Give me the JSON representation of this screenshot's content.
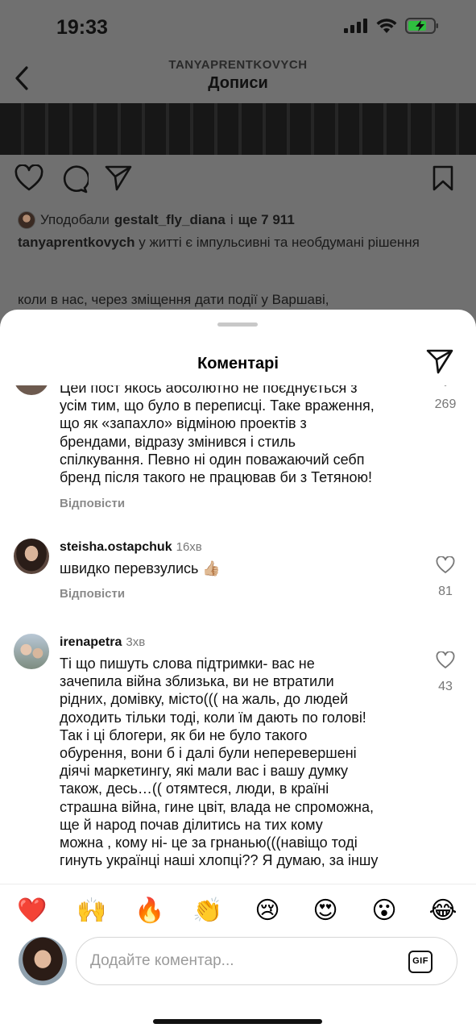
{
  "status_bar": {
    "time": "19:33"
  },
  "post_header": {
    "username": "TANYAPRENTKOVYCH",
    "title": "Дописи"
  },
  "likes": {
    "prefix": "Уподобали",
    "user": "gestalt_fly_diana",
    "joiner": "і",
    "count_text": "ще 7 911"
  },
  "caption": {
    "username": "tanyaprentkovych",
    "text": "у житті є імпульсивні та необдумані рішення",
    "second_line": "коли в нас, через зміщення дати події у Варшаві,"
  },
  "sheet": {
    "title": "Коментарі"
  },
  "comments": [
    {
      "lines": [
        "Цей пост якось абсолютно не поєднується з",
        "усім тим, що було в переписці. Таке враження,",
        "що як «запахло» відміною проектів з",
        "брендами, відразу змінився і стиль",
        "спілкування. Певно ні один поважаючий себп",
        "бренд після  такого не працював би з Тетяною!"
      ],
      "reply": "Відповісти",
      "likes": "269"
    },
    {
      "user": "steisha.ostapchuk",
      "time": "16хв",
      "text": "швидко перевзулись 👍🏼",
      "reply": "Відповісти",
      "likes": "81"
    },
    {
      "user": "irenapetra",
      "time": "3хв",
      "lines": [
        "Ті що пишуть слова підтримки- вас не",
        "зачепила війна  зблизька, ви не втратили",
        "рідних, домівку, місто((( на жаль, до людей",
        "доходить тільки тоді, коли їм дають по голові!",
        "Так і ці блогери, як би не було такого",
        "обурення, вони б і далі були неперевершені",
        "діячі маркетингу, які мали вас і вашу думку",
        "також, десь…(( отямтеся, люди, в країні",
        "страшна війна, гине цвіт, влада не спроможна,",
        "ще й народ почав ділитись на тих кому",
        "можна , кому ні- це за грнанью(((навіщо тоді",
        "гинуть українці наші хлопці?? Я думаю, за іншу"
      ],
      "likes": "43"
    }
  ],
  "emojis": [
    "❤️",
    "🙌",
    "🔥",
    "👏",
    "😢",
    "😍",
    "😮",
    "😂"
  ],
  "composer": {
    "placeholder": "Додайте коментар...",
    "gif_label": "GIF"
  }
}
